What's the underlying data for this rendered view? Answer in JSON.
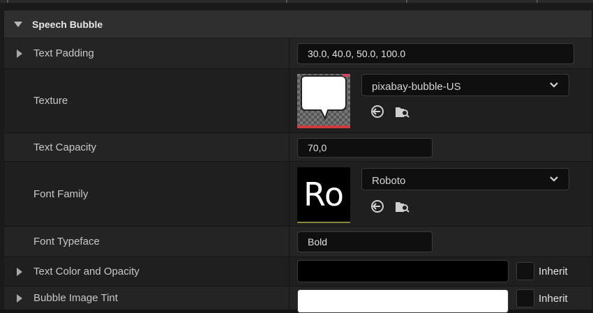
{
  "category": {
    "title": "Speech Bubble"
  },
  "rows": [
    {
      "label": "Text Padding",
      "value": "30.0, 40.0, 50.0, 100.0"
    },
    {
      "label": "Texture",
      "asset": "pixabay-bubble-US"
    },
    {
      "label": "Text Capacity",
      "value": "70,0"
    },
    {
      "label": "Font Family",
      "asset": "Roboto",
      "thumb_text": "Ro"
    },
    {
      "label": "Font Typeface",
      "value": "Bold"
    },
    {
      "label": "Text Color and Opacity",
      "color": "#000000",
      "inherit_label": "Inherit"
    },
    {
      "label": "Bubble Image Tint",
      "color": "#ffffff",
      "inherit_label": "Inherit"
    }
  ],
  "colors": {
    "panel_bg": "#1a1a1a",
    "row_bg_a": "#242424",
    "row_bg_b": "#1f1f1f",
    "category_bg": "#2f2f2f",
    "texture_underline": "#d03c3c",
    "font_underline": "#8a8a3c"
  },
  "icons": {
    "use_selected": "arrow-left-circle-icon",
    "browse": "folder-search-icon",
    "dropdown": "chevron-down-icon",
    "category_expanded": "caret-down-icon",
    "row_collapsed": "caret-right-icon"
  }
}
